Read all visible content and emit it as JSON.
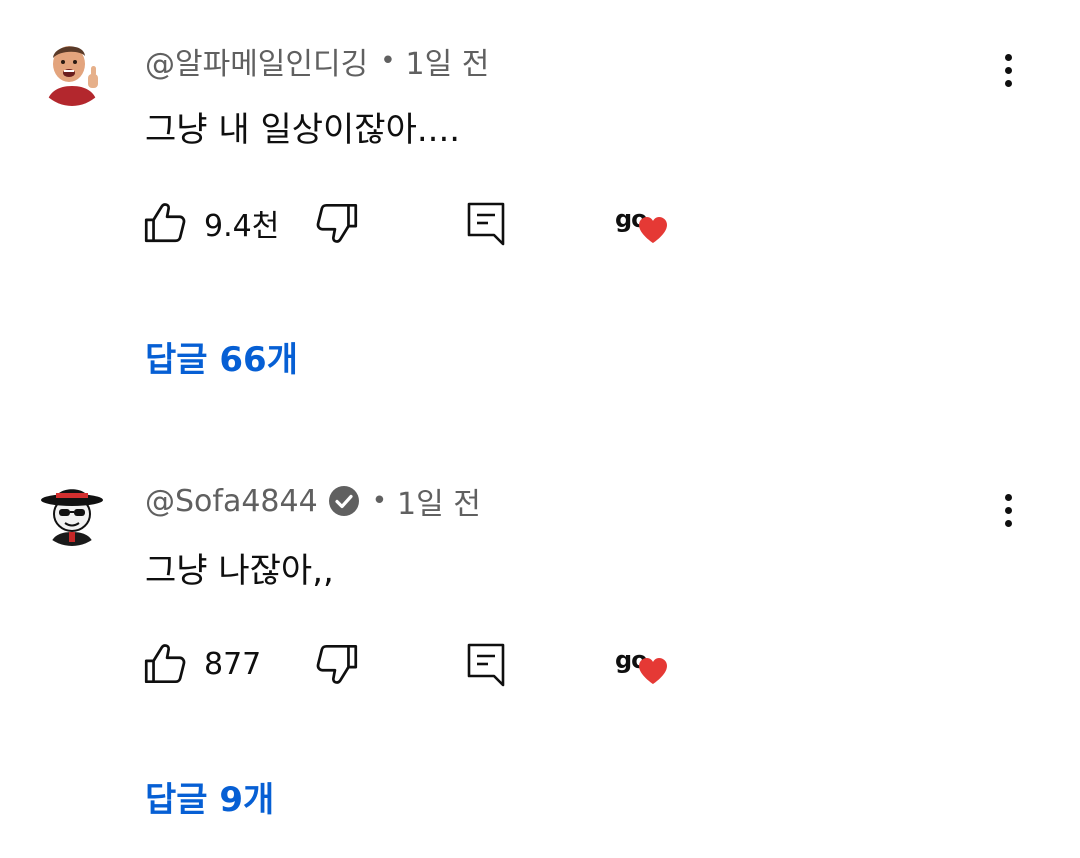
{
  "comments": [
    {
      "author": "@알파메일인디깅",
      "dot": "•",
      "time": "1일 전",
      "verified": false,
      "text": "그냥 내 일상이잖아....",
      "likes": "9.4천",
      "heart_text": "go",
      "replies": "답글 66개"
    },
    {
      "author": "@Sofa4844",
      "dot": "•",
      "time": "1일 전",
      "verified": true,
      "text": "그냥 나잖아,,",
      "likes": "877",
      "heart_text": "go",
      "replies": "답글 9개"
    }
  ],
  "colors": {
    "link": "#065fd4",
    "meta": "#606060",
    "heart": "#e53935"
  },
  "icons": {
    "like": "thumbs-up-icon",
    "dislike": "thumbs-down-icon",
    "reply": "comment-icon",
    "more": "more-vertical-icon",
    "heart": "heart-icon",
    "verified": "verified-check-icon"
  }
}
